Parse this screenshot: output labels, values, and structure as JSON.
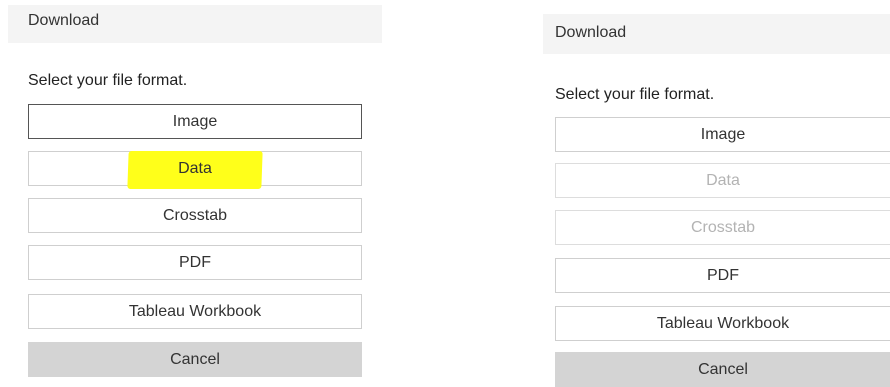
{
  "left": {
    "title": "Download",
    "prompt": "Select your file format.",
    "options": [
      "Image",
      "Data",
      "Crosstab",
      "PDF",
      "Tableau Workbook"
    ],
    "cancel": "Cancel"
  },
  "right": {
    "title": "Download",
    "prompt": "Select your file format.",
    "options": [
      "Image",
      "Data",
      "Crosstab",
      "PDF",
      "Tableau Workbook"
    ],
    "cancel": "Cancel"
  },
  "colors": {
    "highlight": "#ffff1a",
    "header_bg": "#f4f4f4",
    "cancel_bg": "#d4d4d4",
    "disabled_text": "#b3b3b3"
  }
}
